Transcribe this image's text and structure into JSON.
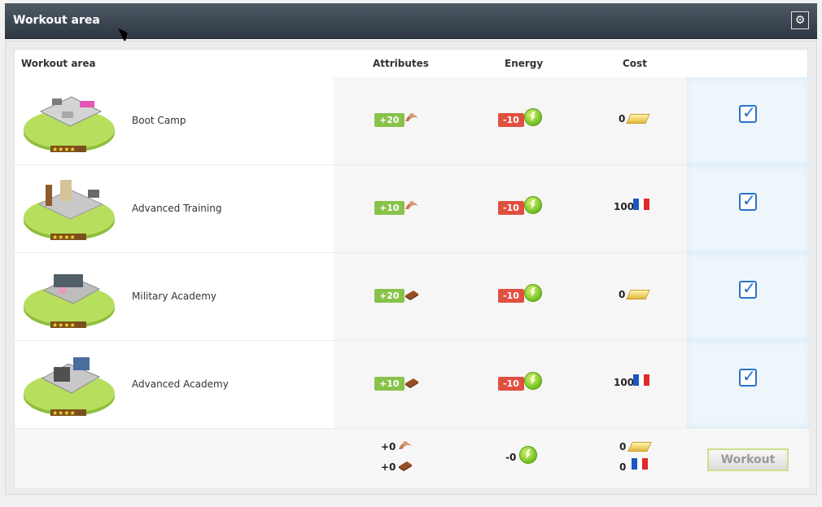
{
  "header": {
    "title": "Workout area",
    "settings_icon": "gear-icon"
  },
  "table": {
    "columns": [
      "Workout area",
      "Attributes",
      "Energy",
      "Cost"
    ],
    "rows": [
      {
        "name": "Boot Camp",
        "attribute": "+20",
        "attribute_icon": "strength-arm-icon",
        "energy": "-10",
        "energy_icon": "energy-icon",
        "cost": "0",
        "cost_icon": "gold-icon",
        "checked": true
      },
      {
        "name": "Advanced Training",
        "attribute": "+10",
        "attribute_icon": "strength-arm-icon",
        "energy": "-10",
        "energy_icon": "energy-icon",
        "cost": "100",
        "cost_icon": "france-flag-icon",
        "checked": true
      },
      {
        "name": "Military Academy",
        "attribute": "+20",
        "attribute_icon": "book-icon",
        "energy": "-10",
        "energy_icon": "energy-icon",
        "cost": "0",
        "cost_icon": "gold-icon",
        "checked": true
      },
      {
        "name": "Advanced Academy",
        "attribute": "+10",
        "attribute_icon": "book-icon",
        "energy": "-10",
        "energy_icon": "energy-icon",
        "cost": "100",
        "cost_icon": "france-flag-icon",
        "checked": true
      }
    ],
    "summary": {
      "strength": "+0",
      "knowledge": "+0",
      "energy": "-0",
      "gold": "0",
      "currency": "0"
    },
    "workout_button": "Workout"
  },
  "colors": {
    "header_dark": "#2f3843",
    "green_badge": "#88c24b",
    "red_badge": "#e05040",
    "checkbox_blue": "#2a74c7"
  }
}
